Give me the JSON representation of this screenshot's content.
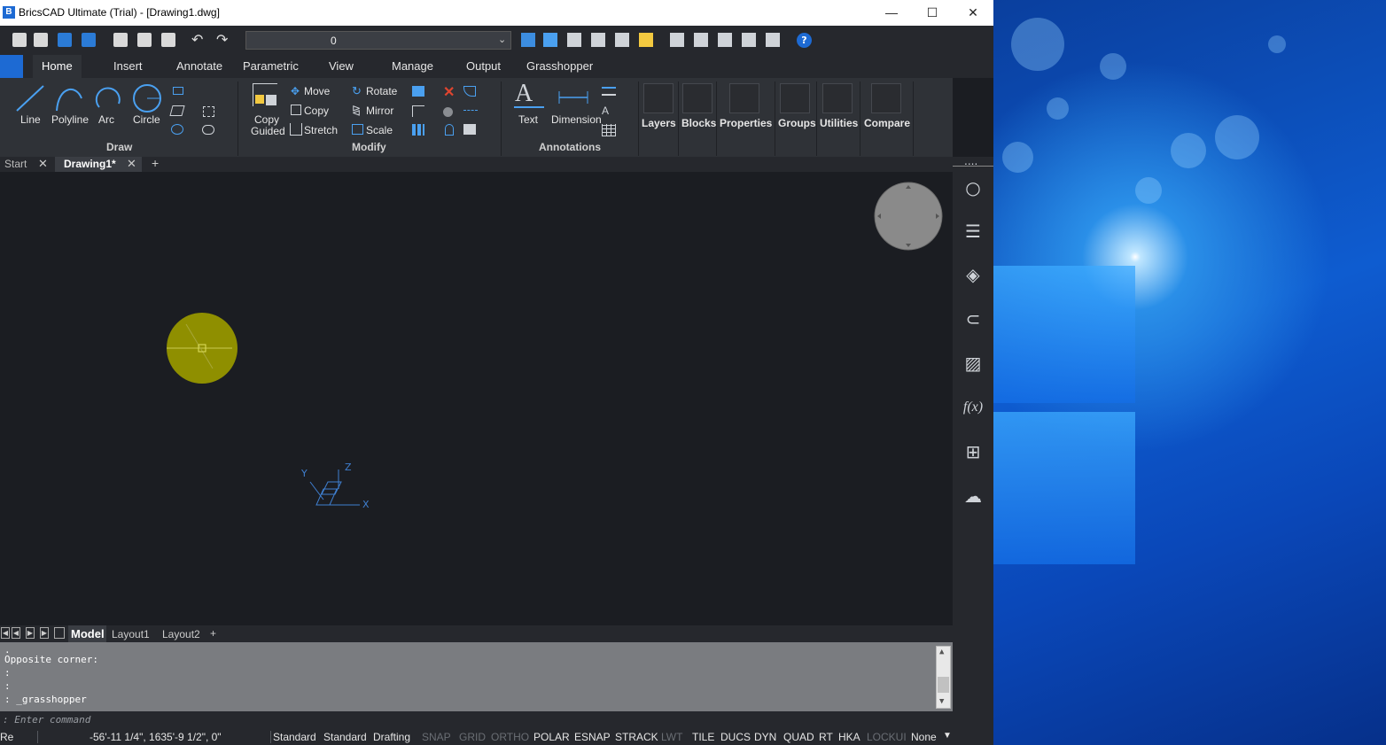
{
  "window": {
    "title": "BricsCAD Ultimate (Trial) - [Drawing1.dwg]",
    "logo": "B",
    "minimize": "—",
    "maximize": "☐",
    "close": "✕"
  },
  "quick_access": {
    "layer_value": "0",
    "help_icon": "?"
  },
  "ribbon_tabs": [
    "Home",
    "Insert",
    "Annotate",
    "Parametric",
    "View",
    "Manage",
    "Output",
    "Grasshopper"
  ],
  "ribbon": {
    "draw": {
      "name": "Draw",
      "line": "Line",
      "polyline": "Polyline",
      "arc": "Arc",
      "circle": "Circle"
    },
    "modify": {
      "name": "Modify",
      "copy_guided_1": "Copy",
      "copy_guided_2": "Guided",
      "move": "Move",
      "copy": "Copy",
      "stretch": "Stretch",
      "rotate": "Rotate",
      "mirror": "Mirror",
      "scale": "Scale"
    },
    "annotations": {
      "name": "Annotations",
      "text": "Text",
      "dimension": "Dimension"
    },
    "panels": [
      "Layers",
      "Blocks",
      "Properties",
      "Groups",
      "Utilities",
      "Compare"
    ]
  },
  "doc_tabs": {
    "start": "Start",
    "drawing": "Drawing1*",
    "add": "+"
  },
  "ucs": {
    "x": "X",
    "y": "Y",
    "z": "Z"
  },
  "layout_tabs": {
    "model": "Model",
    "layout1": "Layout1",
    "layout2": "Layout2",
    "add": "+"
  },
  "command_history": [
    ".",
    "Opposite corner:",
    ":",
    ":",
    ": _grasshopper"
  ],
  "command_prompt": ": Enter command",
  "status": {
    "left": "Re",
    "coords": "-56'-11 1/4\", 1635'-9 1/2\", 0\"",
    "items": [
      {
        "label": "Standard",
        "on": true
      },
      {
        "label": "Standard",
        "on": true
      },
      {
        "label": "Drafting",
        "on": true
      },
      {
        "label": "SNAP",
        "on": false
      },
      {
        "label": "GRID",
        "on": false
      },
      {
        "label": "ORTHO",
        "on": false
      },
      {
        "label": "POLAR",
        "on": true
      },
      {
        "label": "ESNAP",
        "on": true
      },
      {
        "label": "STRACK",
        "on": true
      },
      {
        "label": "LWT",
        "on": false
      },
      {
        "label": "TILE",
        "on": true
      },
      {
        "label": "DUCS",
        "on": true
      },
      {
        "label": "DYN",
        "on": true
      },
      {
        "label": "QUAD",
        "on": true
      },
      {
        "label": "RT",
        "on": true
      },
      {
        "label": "HKA",
        "on": true
      },
      {
        "label": "LOCKUI",
        "on": false
      },
      {
        "label": "None",
        "on": true
      }
    ]
  },
  "right_panel": {
    "more": "....",
    "fx": "f(x)"
  },
  "colors": {
    "canvas": "#1b1d22",
    "circle_fill": "#8f8f00",
    "accent_blue": "#1d6ad3"
  }
}
